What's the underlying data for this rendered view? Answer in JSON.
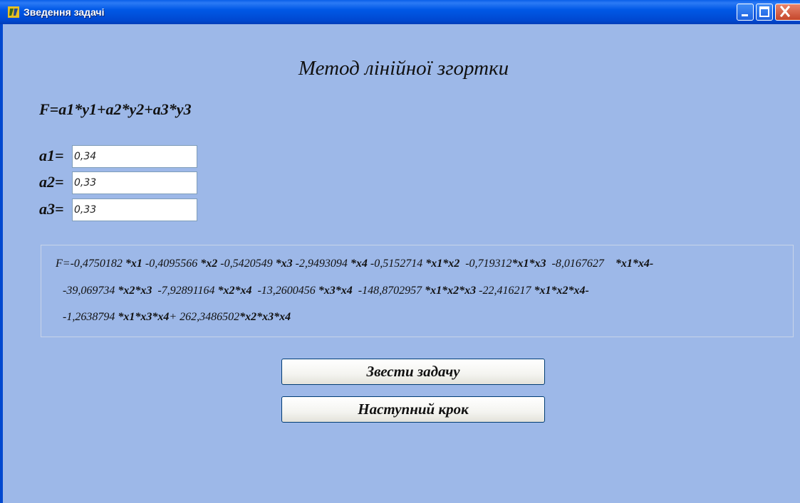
{
  "window": {
    "title": "Зведення задачі",
    "colors": {
      "titlebar": "#0058e6",
      "client_bg": "#9db8e8",
      "close_button": "#c4462a"
    }
  },
  "header": {
    "heading": "Метод лінійної згортки",
    "formula": "F=a1*y1+a2*y2+a3*y3"
  },
  "coefficients": [
    {
      "label": "a1=",
      "value": "0,34"
    },
    {
      "label": "a2=",
      "value": "0,33"
    },
    {
      "label": "a3=",
      "value": "0,33"
    }
  ],
  "result": {
    "line1": [
      [
        "F=-0,4750182 ",
        false
      ],
      [
        "*x1",
        true
      ],
      [
        " -0,4095566 ",
        false
      ],
      [
        "*x2",
        true
      ],
      [
        " -0,5420549 ",
        false
      ],
      [
        "*x3",
        true
      ],
      [
        " -2,9493094 ",
        false
      ],
      [
        "*x4",
        true
      ],
      [
        " -0,5152714 ",
        false
      ],
      [
        "*x1*x2",
        true
      ],
      [
        "  -0,719312",
        false
      ],
      [
        "*x1*x3",
        true
      ],
      [
        "  -8,0167627    ",
        false
      ],
      [
        "*x1*x4-",
        true
      ]
    ],
    "line2": [
      [
        "-39,069734 ",
        false
      ],
      [
        "*x2*x3",
        true
      ],
      [
        "  -7,92891164 ",
        false
      ],
      [
        "*x2*x4",
        true
      ],
      [
        "  -13,2600456 ",
        false
      ],
      [
        "*x3*x4",
        true
      ],
      [
        "  -148,8702957 ",
        false
      ],
      [
        "*x1*x2*x3",
        true
      ],
      [
        " -22,416217 ",
        false
      ],
      [
        "*x1*x2*x4-",
        true
      ]
    ],
    "line3": [
      [
        "-1,2638794 ",
        false
      ],
      [
        "*x1*x3*x4",
        true
      ],
      [
        "+ 262,3486502",
        false
      ],
      [
        "*x2*x3*x4",
        true
      ]
    ]
  },
  "buttons": {
    "reduce_label": "Звести задачу",
    "next_label": "Наступний крок"
  },
  "icons": {
    "app": "delphi-app-icon",
    "minimize": "minimize-icon",
    "maximize": "maximize-icon",
    "close": "close-icon"
  }
}
